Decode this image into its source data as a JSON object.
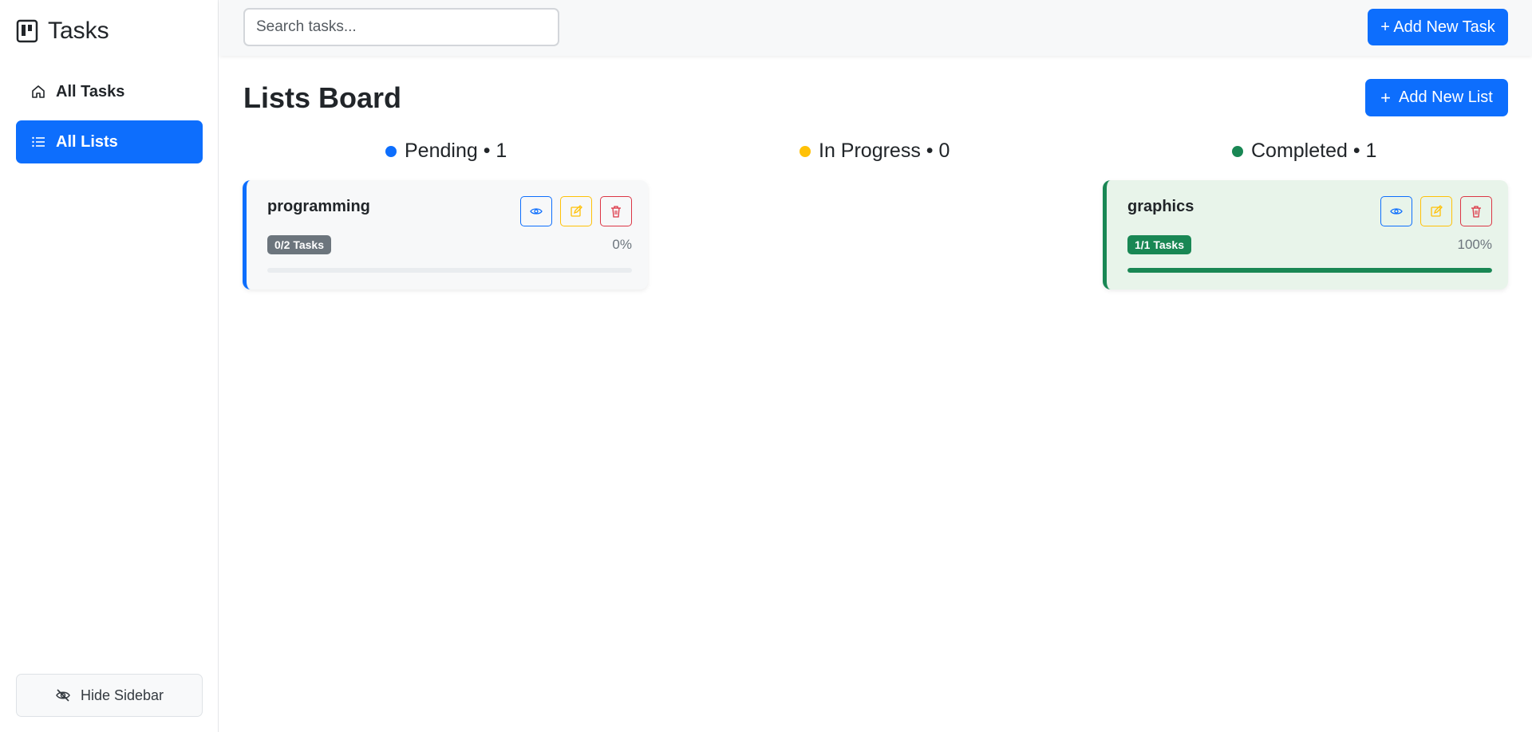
{
  "sidebar": {
    "brand": "Tasks",
    "items": [
      {
        "label": "All Tasks",
        "icon": "home-icon"
      },
      {
        "label": "All Lists",
        "icon": "list-icon",
        "active": true
      }
    ],
    "hide_label": "Hide Sidebar"
  },
  "topbar": {
    "search_placeholder": "Search tasks...",
    "add_task_label": "+ Add New Task"
  },
  "main": {
    "title": "Lists Board",
    "add_list_label": "Add New List",
    "columns": [
      {
        "label": "Pending • 1",
        "color": "#0d6efd"
      },
      {
        "label": "In Progress • 0",
        "color": "#ffc107"
      },
      {
        "label": "Completed • 1",
        "color": "#198754"
      }
    ],
    "cards": [
      {
        "name": "programming",
        "tasks": "0/2 Tasks",
        "percent_label": "0%",
        "progress": 0,
        "column": "Pending",
        "accent": "#0d6efd"
      },
      {
        "name": "graphics",
        "tasks": "1/1 Tasks",
        "percent_label": "100%",
        "progress": 1,
        "column": "Completed",
        "accent": "#198754"
      }
    ]
  }
}
